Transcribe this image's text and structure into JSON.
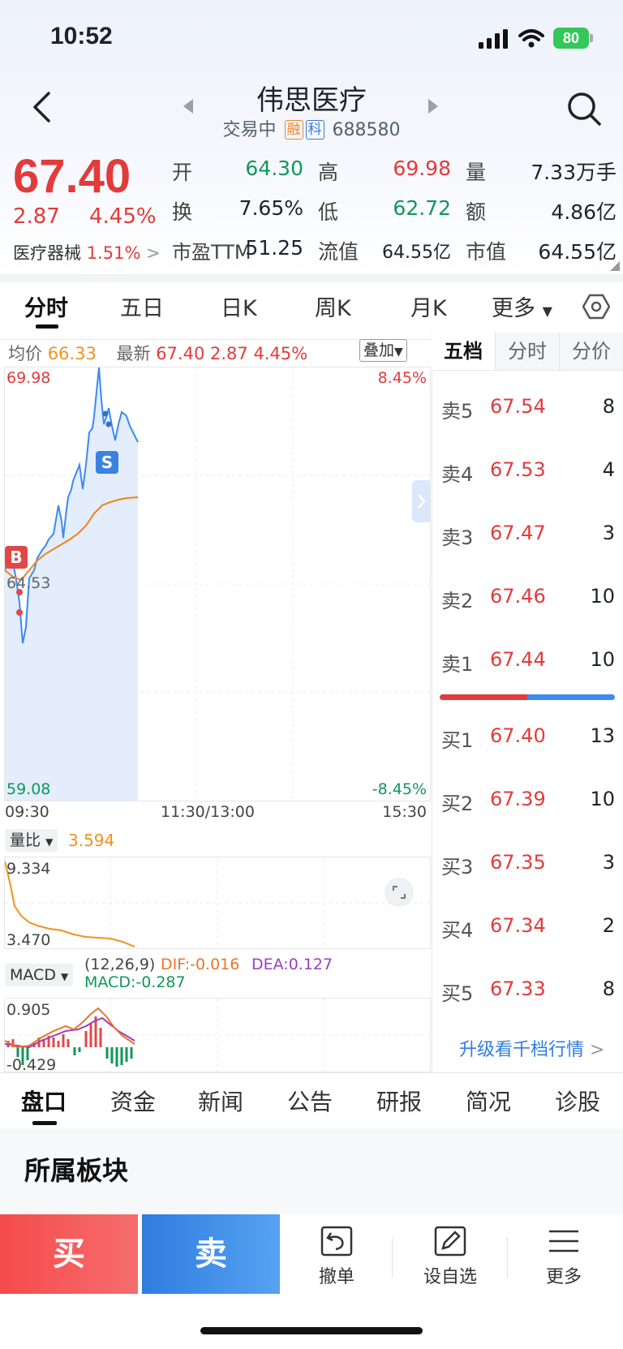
{
  "status": {
    "time": "10:52",
    "battery": "80"
  },
  "header": {
    "title": "伟思医疗",
    "status_text": "交易中",
    "tag_margin": "融",
    "tag_star": "科",
    "code": "688580"
  },
  "quote": {
    "price": "67.40",
    "change": "2.87",
    "change_pct": "4.45%",
    "sector_name": "医疗器械",
    "sector_pct": "1.51%",
    "stats": [
      {
        "label": "开",
        "value": "64.30",
        "tone": "green"
      },
      {
        "label": "高",
        "value": "69.98",
        "tone": "red"
      },
      {
        "label": "量",
        "value": "7.33万手",
        "tone": "dark"
      },
      {
        "label": "换",
        "value": "7.65%",
        "tone": "dark"
      },
      {
        "label": "低",
        "value": "62.72",
        "tone": "green"
      },
      {
        "label": "额",
        "value": "4.86亿",
        "tone": "dark"
      },
      {
        "label": "市盈TTM",
        "value": "51.25",
        "tone": "dark"
      },
      {
        "label": "流值",
        "value": "64.55亿",
        "tone": "dark"
      },
      {
        "label": "市值",
        "value": "64.55亿",
        "tone": "dark"
      }
    ]
  },
  "chart_tabs": [
    "分时",
    "五日",
    "日K",
    "周K",
    "月K",
    "更多"
  ],
  "intraday": {
    "avg_label": "均价",
    "avg_value": "66.33",
    "latest_label": "最新",
    "latest_value": "67.40",
    "latest_change": "2.87",
    "latest_pct": "4.45%",
    "overlay_btn": "叠加",
    "y_high": "69.98",
    "y_low": "59.08",
    "y_mid": "64.53",
    "pct_high": "8.45%",
    "pct_low": "-8.45%",
    "time_start": "09:30",
    "time_mid": "11:30/13:00",
    "time_end": "15:30",
    "marker_buy": "B",
    "marker_sell": "S"
  },
  "volume_ratio": {
    "label": "量比",
    "value": "3.594",
    "y_high": "9.334",
    "y_low": "3.470"
  },
  "macd": {
    "label": "MACD",
    "params": "(12,26,9)",
    "dif": "DIF:-0.016",
    "dea": "DEA:0.127",
    "macd": "MACD:-0.287",
    "y_high": "0.905",
    "y_low": "-0.429"
  },
  "orderbook": {
    "tabs": [
      "五档",
      "分时",
      "分价"
    ],
    "asks": [
      {
        "label": "卖5",
        "price": "67.54",
        "vol": "8"
      },
      {
        "label": "卖4",
        "price": "67.53",
        "vol": "4"
      },
      {
        "label": "卖3",
        "price": "67.47",
        "vol": "3"
      },
      {
        "label": "卖2",
        "price": "67.46",
        "vol": "10"
      },
      {
        "label": "卖1",
        "price": "67.44",
        "vol": "10"
      }
    ],
    "bids": [
      {
        "label": "买1",
        "price": "67.40",
        "vol": "13"
      },
      {
        "label": "买2",
        "price": "67.39",
        "vol": "10"
      },
      {
        "label": "买3",
        "price": "67.35",
        "vol": "3"
      },
      {
        "label": "买4",
        "price": "67.34",
        "vol": "2"
      },
      {
        "label": "买5",
        "price": "67.33",
        "vol": "8"
      }
    ],
    "upgrade_link": "升级看千档行情"
  },
  "bottom_tabs": [
    "盘口",
    "资金",
    "新闻",
    "公告",
    "研报",
    "简况",
    "诊股"
  ],
  "section_title": "所属板块",
  "actions": {
    "buy": "买",
    "sell": "卖",
    "cancel": "撤单",
    "watch": "设自选",
    "more": "更多"
  }
}
